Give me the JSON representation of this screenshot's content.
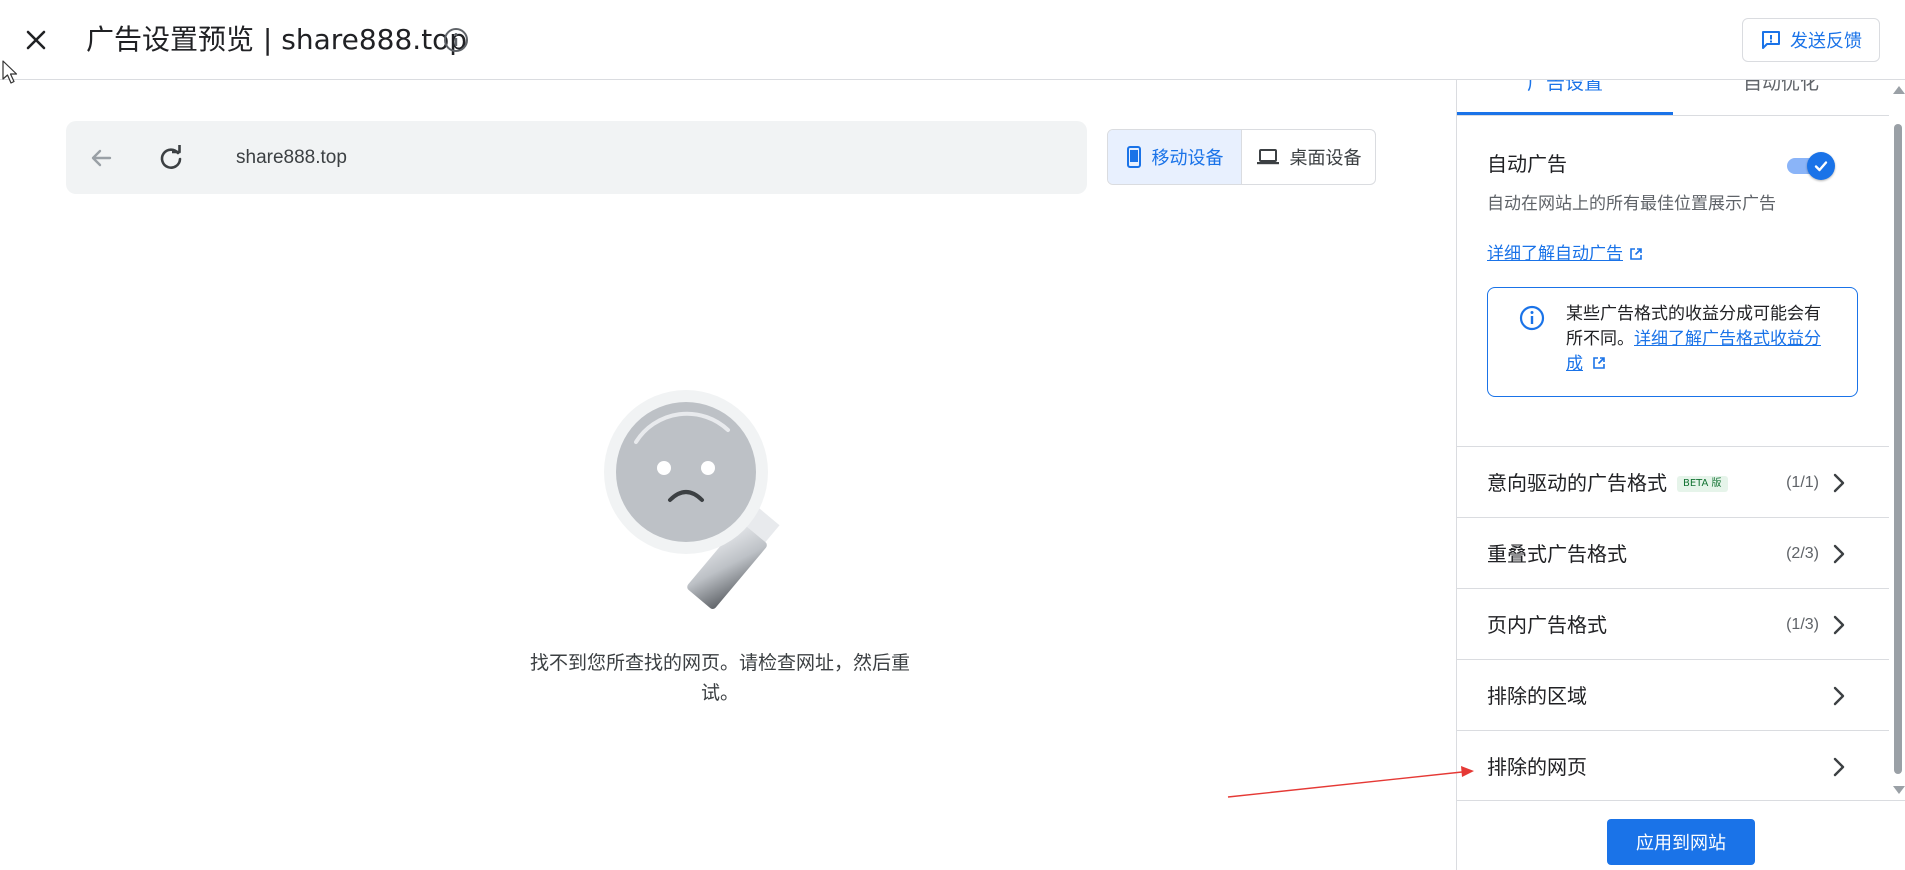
{
  "header": {
    "title": "广告设置预览 | share888.top",
    "feedback_label": "发送反馈"
  },
  "browser": {
    "url": "share888.top",
    "devices": {
      "mobile": "移动设备",
      "desktop": "桌面设备"
    }
  },
  "preview": {
    "message": "找不到您所查找的网页。请检查网址，然后重试。"
  },
  "panel": {
    "tabs": [
      {
        "label": "广告设置",
        "active": true
      },
      {
        "label": "自动优化",
        "active": false
      }
    ],
    "auto_ads": {
      "title": "自动广告",
      "enabled": true,
      "description": "自动在网站上的所有最佳位置展示广告",
      "learn_more": "详细了解自动广告"
    },
    "info_box": {
      "text": "某些广告格式的收益分成可能会有所不同。",
      "link": "详细了解广告格式收益分成"
    },
    "rows": [
      {
        "label": "意向驱动的广告格式",
        "badge": "BETA 版",
        "count": "(1/1)"
      },
      {
        "label": "重叠式广告格式",
        "count": "(2/3)"
      },
      {
        "label": "页内广告格式",
        "count": "(1/3)"
      },
      {
        "label": "排除的区域"
      },
      {
        "label": "排除的网页"
      }
    ],
    "apply_label": "应用到网站"
  },
  "colors": {
    "accent": "#1a73e8",
    "annotation_arrow": "#e53935"
  }
}
